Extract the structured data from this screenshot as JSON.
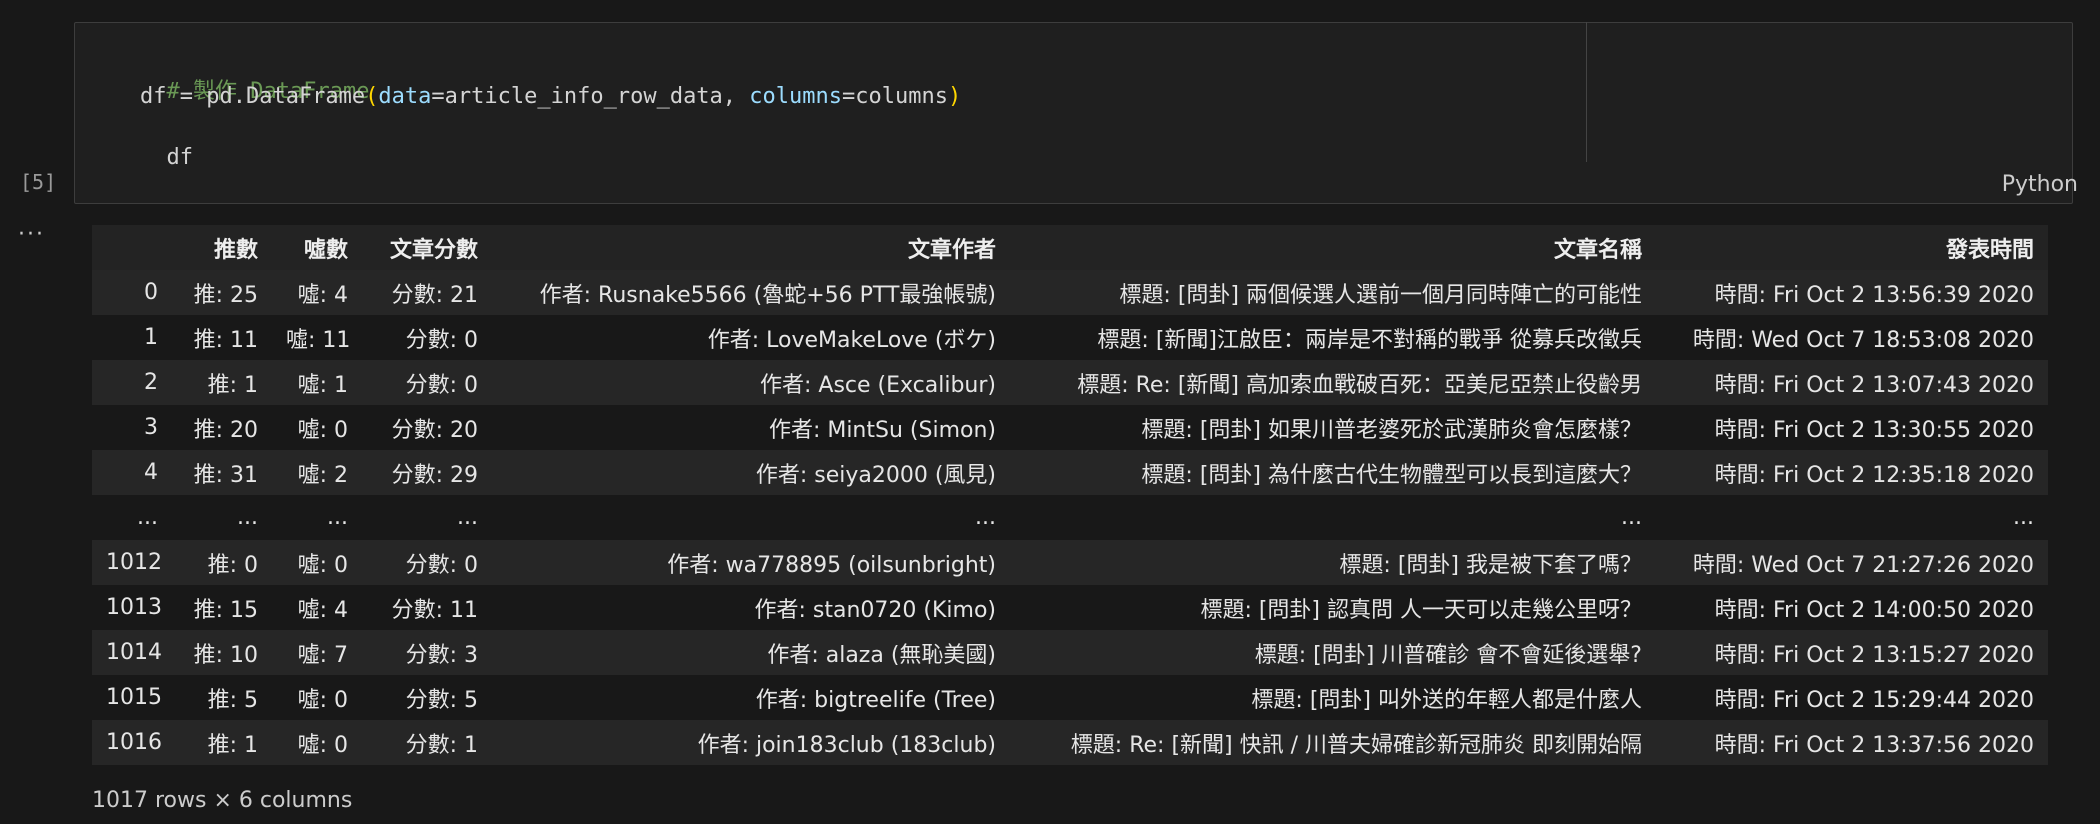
{
  "cell": {
    "execution_count": "[5]",
    "language": "Python",
    "code": {
      "line1": "# 製作 DataFrame",
      "line2_df": "df = pd.DataFrame",
      "line2_open": "(",
      "line2_param1": "data",
      "line2_eq1": "=article_info_row_data, ",
      "line2_param2": "columns",
      "line2_eq2": "=columns",
      "line2_close": ")",
      "line3": "df"
    }
  },
  "output": {
    "ellipsis": "···",
    "columns": [
      "",
      "推數",
      "噓數",
      "文章分數",
      "文章作者",
      "文章名稱",
      "發表時間"
    ],
    "rows": [
      [
        "0",
        "推: 25",
        "噓: 4",
        "分數: 21",
        "作者: Rusnake5566 (魯蛇+56 PTT最強帳號)",
        "標題: [問卦] 兩個候選人選前一個月同時陣亡的可能性",
        "時間: Fri Oct 2 13:56:39 2020"
      ],
      [
        "1",
        "推: 11",
        "噓: 11",
        "分數: 0",
        "作者: LoveMakeLove (ボケ)",
        "標題: [新聞]江啟臣：兩岸是不對稱的戰爭 從募兵改徵兵",
        "時間: Wed Oct 7 18:53:08 2020"
      ],
      [
        "2",
        "推: 1",
        "噓: 1",
        "分數: 0",
        "作者: Asce (Excalibur)",
        "標題: Re: [新聞] 高加索血戰破百死：亞美尼亞禁止役齡男",
        "時間: Fri Oct 2 13:07:43 2020"
      ],
      [
        "3",
        "推: 20",
        "噓: 0",
        "分數: 20",
        "作者: MintSu (Simon)",
        "標題: [問卦] 如果川普老婆死於武漢肺炎會怎麼樣？",
        "時間: Fri Oct 2 13:30:55 2020"
      ],
      [
        "4",
        "推: 31",
        "噓: 2",
        "分數: 29",
        "作者: seiya2000 (風見)",
        "標題: [問卦] 為什麼古代生物體型可以長到這麼大？",
        "時間: Fri Oct 2 12:35:18 2020"
      ],
      [
        "...",
        "...",
        "...",
        "...",
        "...",
        "...",
        "..."
      ],
      [
        "1012",
        "推: 0",
        "噓: 0",
        "分數: 0",
        "作者: wa778895 (oilsunbright)",
        "標題: [問卦] 我是被下套了嗎？",
        "時間: Wed Oct 7 21:27:26 2020"
      ],
      [
        "1013",
        "推: 15",
        "噓: 4",
        "分數: 11",
        "作者: stan0720 (Kimo)",
        "標題: [問卦] 認真問 人一天可以走幾公里呀？",
        "時間: Fri Oct 2 14:00:50 2020"
      ],
      [
        "1014",
        "推: 10",
        "噓: 7",
        "分數: 3",
        "作者: alaza (無恥美國)",
        "標題: [問卦] 川普確診 會不會延後選舉?",
        "時間: Fri Oct 2 13:15:27 2020"
      ],
      [
        "1015",
        "推: 5",
        "噓: 0",
        "分數: 5",
        "作者: bigtreelife (Tree)",
        "標題: [問卦] 叫外送的年輕人都是什麼人",
        "時間: Fri Oct 2 15:29:44 2020"
      ],
      [
        "1016",
        "推: 1",
        "噓: 0",
        "分數: 1",
        "作者: join183club (183club)",
        "標題: Re: [新聞] 快訊 / 川普夫婦確診新冠肺炎 即刻開始隔",
        "時間: Fri Oct 2 13:37:56 2020"
      ]
    ],
    "shape": "1017 rows × 6 columns"
  }
}
